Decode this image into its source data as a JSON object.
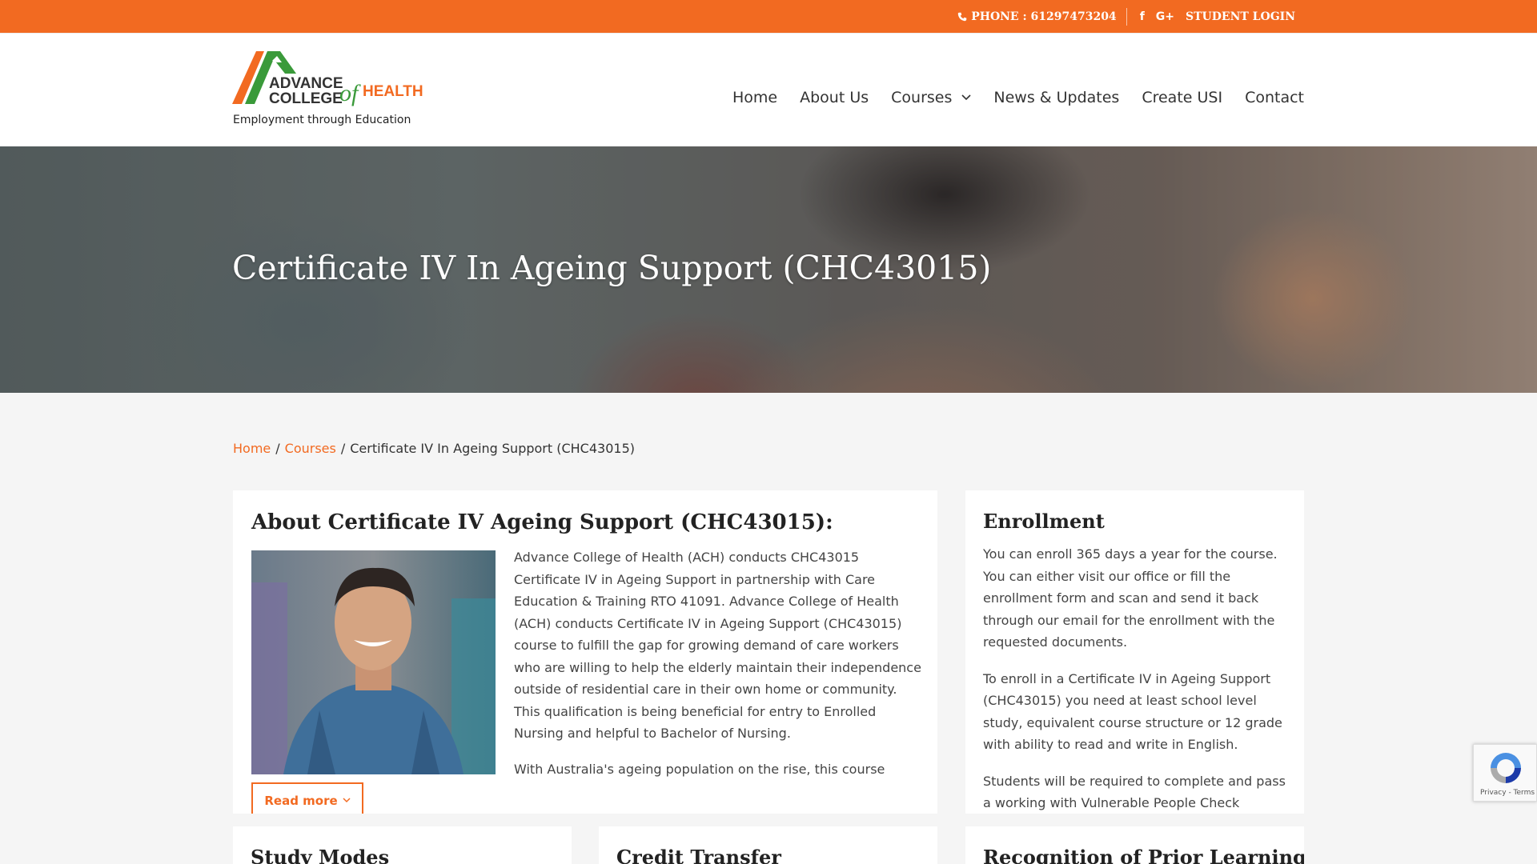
{
  "topbar": {
    "phone": "PHONE : 61297473204",
    "facebook_icon": "f",
    "google_icon": "G+",
    "student_login": "STUDENT LOGIN"
  },
  "logo": {
    "line1": "ADVANCE",
    "line2": "COLLEGE",
    "of": "of",
    "health": "HEALTH",
    "tagline": "Employment through Education"
  },
  "nav": {
    "items": [
      "Home",
      "About Us",
      "Courses",
      "News & Updates",
      "Create USI",
      "Contact"
    ]
  },
  "hero": {
    "title": "Certificate IV In Ageing Support (CHC43015)"
  },
  "breadcrumb": {
    "home": "Home",
    "sep": "/",
    "courses": "Courses",
    "current": "Certificate IV In Ageing Support (CHC43015)"
  },
  "about": {
    "heading": "About Certificate IV Ageing Support (CHC43015):",
    "paragraphs": [
      "Advance College of Health (ACH) conducts CHC43015 Certificate IV in Ageing Support in partnership with Care Education & Training RTO 41091. Advance College of Health (ACH) conducts Certificate IV in Ageing Support (CHC43015) course to fulfill the gap for growing demand of care workers who are willing to help the elderly maintain their independence outside of residential care in their own home or community. This qualification is being beneficial for entry to Enrolled Nursing and helpful to Bachelor of Nursing.",
      "With Australia's ageing population on the rise, this course"
    ],
    "read_more": "Read more"
  },
  "enrollment": {
    "heading": "Enrollment",
    "paragraphs": [
      "You can enroll 365 days a year for the course. You can either visit our office or fill the enrollment form and scan and send it back through our email for the enrollment with the requested documents.",
      "To enroll in a Certificate IV in Ageing Support (CHC43015) you need at least school level study, equivalent course structure or 12 grade with ability to read and write in English.",
      "Students will be required to complete and pass a working with Vulnerable People Check"
    ]
  },
  "cards": {
    "study_modes": "Study Modes",
    "credit_transfer": "Credit Transfer",
    "rpl": "Recognition of Prior Learning"
  },
  "recaptcha": {
    "terms": "Privacy - Terms"
  },
  "colors": {
    "accent": "#f26a21",
    "logo_green": "#3a9a3a"
  }
}
